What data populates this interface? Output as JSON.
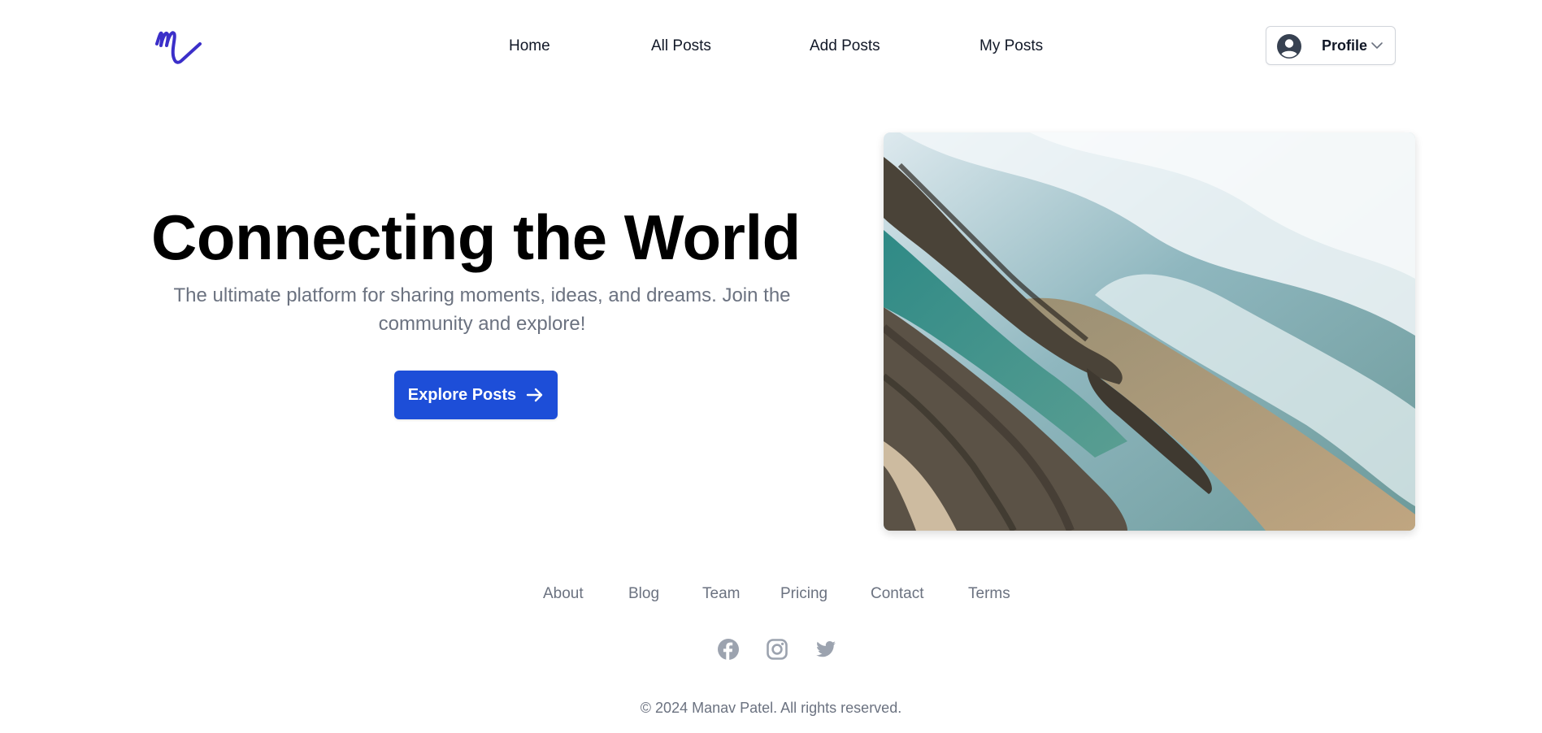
{
  "header": {
    "logo_alt": "logo",
    "nav": [
      {
        "label": "Home"
      },
      {
        "label": "All Posts"
      },
      {
        "label": "Add Posts"
      },
      {
        "label": "My Posts"
      }
    ],
    "profile": {
      "label": "Profile"
    }
  },
  "hero": {
    "title": "Connecting the World",
    "subtitle": "The ultimate platform for sharing moments, ideas, and dreams. Join the community and explore!",
    "cta_label": "Explore Posts"
  },
  "footer": {
    "links": [
      {
        "label": "About"
      },
      {
        "label": "Blog"
      },
      {
        "label": "Team"
      },
      {
        "label": "Pricing"
      },
      {
        "label": "Contact"
      },
      {
        "label": "Terms"
      }
    ],
    "social": [
      {
        "icon": "facebook-icon"
      },
      {
        "icon": "instagram-icon"
      },
      {
        "icon": "twitter-icon"
      }
    ],
    "copyright": "© 2024 Manav Patel. All rights reserved."
  },
  "colors": {
    "brand": "#3b2fc9",
    "primary_button": "#1d4ed8",
    "muted_text": "#6b7280",
    "social_icon": "#9ca3af"
  }
}
